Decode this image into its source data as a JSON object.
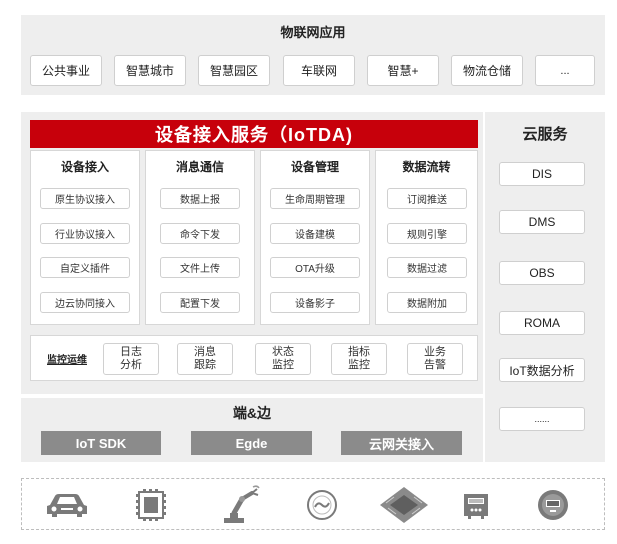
{
  "iot_apps": {
    "title": "物联网应用",
    "items": [
      "公共事业",
      "智慧城市",
      "智慧园区",
      "车联网",
      "智慧+",
      "物流仓储",
      "..."
    ]
  },
  "iotda": {
    "title": "设备接入服务（IoTDA)",
    "columns": [
      {
        "title": "设备接入",
        "items": [
          "原生协议接入",
          "行业协议接入",
          "自定义插件",
          "边云协同接入"
        ]
      },
      {
        "title": "消息通信",
        "items": [
          "数据上报",
          "命令下发",
          "文件上传",
          "配置下发"
        ]
      },
      {
        "title": "设备管理",
        "items": [
          "生命周期管理",
          "设备建模",
          "OTA升级",
          "设备影子"
        ]
      },
      {
        "title": "数据流转",
        "items": [
          "订阅推送",
          "规则引擎",
          "数据过滤",
          "数据附加"
        ]
      }
    ],
    "monitor": {
      "title": "监控运维",
      "items": [
        {
          "line1": "日志",
          "line2": "分析"
        },
        {
          "line1": "消息",
          "line2": "跟踪"
        },
        {
          "line1": "状态",
          "line2": "监控"
        },
        {
          "line1": "指标",
          "line2": "监控"
        },
        {
          "line1": "业务",
          "line2": "告警"
        }
      ]
    }
  },
  "edge": {
    "title": "端&边",
    "items": [
      "IoT SDK",
      "Egde",
      "云网关接入"
    ]
  },
  "cloud": {
    "title": "云服务",
    "items": [
      "DIS",
      "DMS",
      "OBS",
      "ROMA",
      "IoT数据分析",
      "......"
    ]
  },
  "devices": [
    "car-icon",
    "chip-icon",
    "robot-arm-icon",
    "meter-icon",
    "circuit-board-icon",
    "gateway-icon",
    "smart-meter-icon"
  ],
  "colors": {
    "accent": "#c7000b",
    "panel": "#eeeeee",
    "button": "#8b8b8b"
  }
}
